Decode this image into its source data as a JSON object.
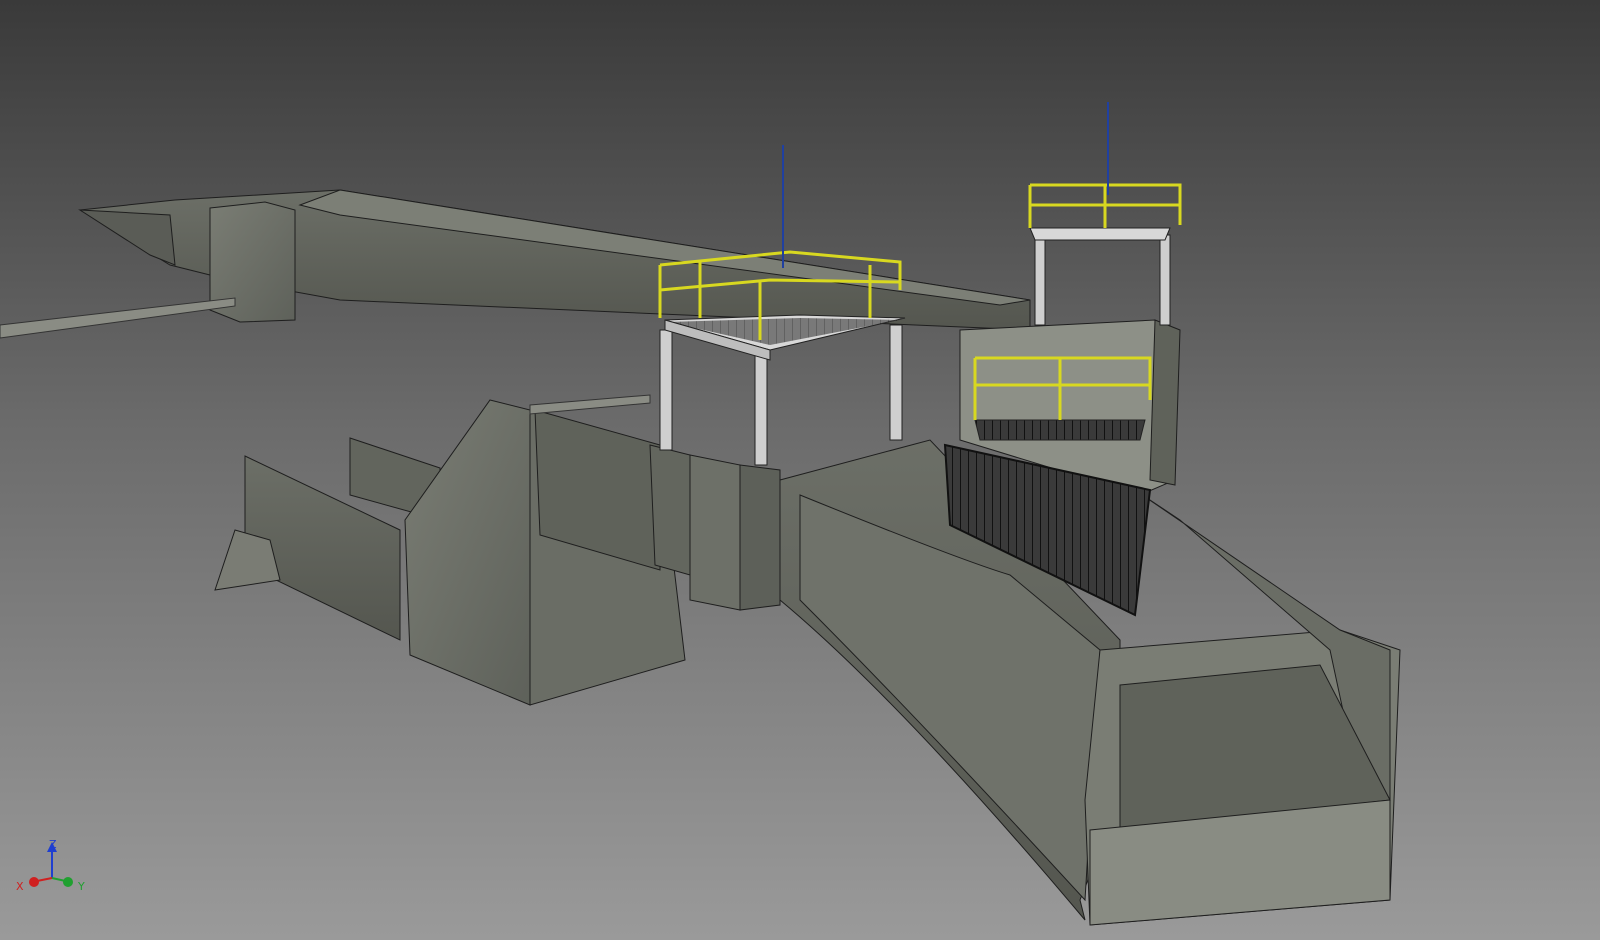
{
  "viewport": {
    "background_top": "#3a3a3a",
    "background_bottom": "#9a9a9a"
  },
  "model": {
    "concrete_color": "#6f726a",
    "concrete_dark": "#5a5c56",
    "concrete_light": "#8a8d84",
    "edge_color": "#1e1e1e",
    "railing_color": "#d8d820",
    "steel_color": "#d0d0d0",
    "pole_color": "#2040a0",
    "grate_color": "#1a1a1a"
  },
  "triad": {
    "z_label": "Z",
    "x_label": "X",
    "y_label": "Y",
    "z_color": "#1f3fd0",
    "x_color": "#d02020",
    "y_color": "#20a030"
  }
}
